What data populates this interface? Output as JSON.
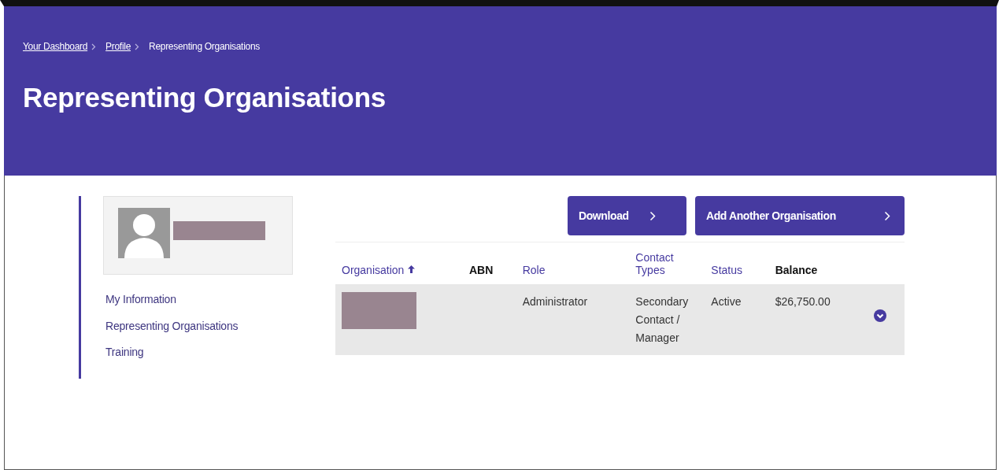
{
  "breadcrumb": [
    {
      "label": "Your Dashboard",
      "link": true
    },
    {
      "label": "Profile",
      "link": true
    },
    {
      "label": "Representing Organisations",
      "link": false
    }
  ],
  "title": "Representing Organisations",
  "sidebar": {
    "items": [
      {
        "label": "My Information"
      },
      {
        "label": "Representing Organisations"
      },
      {
        "label": "Training"
      }
    ]
  },
  "actions": [
    "Download",
    "Add Another Organisation"
  ],
  "table": {
    "columns": [
      {
        "label": "Organisation",
        "sortable": true,
        "sorted": true
      },
      {
        "label": "ABN",
        "sortable": false,
        "sorted": false
      },
      {
        "label": "Role",
        "sortable": true,
        "sorted": false
      },
      {
        "label": "Contact Types",
        "sortable": true,
        "sorted": false
      },
      {
        "label": "Status",
        "sortable": true,
        "sorted": false
      },
      {
        "label": "Balance",
        "sortable": false,
        "sorted": false
      }
    ],
    "rows": [
      {
        "cells": [
          "",
          "",
          "Administrator",
          "Secondary Contact / Manager",
          "Active",
          "$26,750.00"
        ],
        "expanded": false
      }
    ]
  }
}
